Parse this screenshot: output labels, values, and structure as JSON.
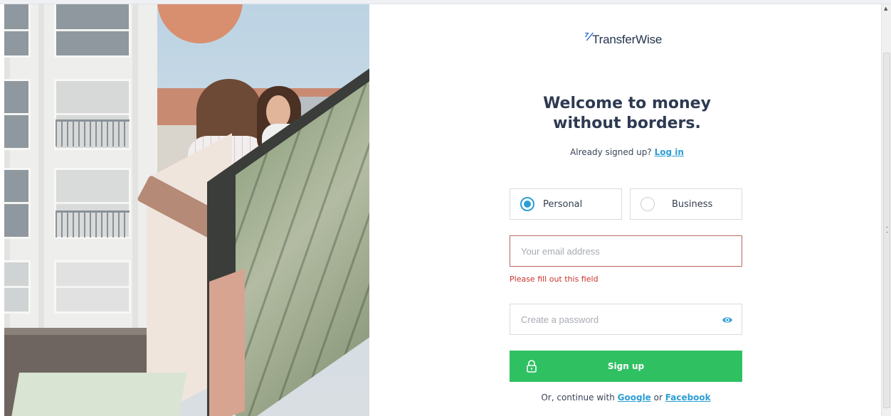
{
  "brand": {
    "name": "TransferWise",
    "logo_icon": "transferwise-flag-icon",
    "color": "#2c6dd4"
  },
  "headline": {
    "line1": "Welcome to money",
    "line2": "without borders."
  },
  "login_prompt": {
    "text": "Already signed up? ",
    "link": "Log in"
  },
  "account_types": [
    {
      "label": "Personal",
      "selected": true
    },
    {
      "label": "Business",
      "selected": false
    }
  ],
  "email": {
    "placeholder": "Your email address",
    "value": "",
    "error": "Please fill out this field"
  },
  "password": {
    "placeholder": "Create a password",
    "value": "",
    "toggle_icon": "eye-icon"
  },
  "signup": {
    "label": "Sign up",
    "icon": "lock-icon",
    "color": "#2fc062"
  },
  "social": {
    "prefix": "Or, continue with ",
    "google": "Google",
    "separator": " or ",
    "facebook": "Facebook"
  },
  "colors": {
    "accent": "#2d9ed4",
    "error": "#c9342b",
    "heading": "#2e3a52"
  }
}
